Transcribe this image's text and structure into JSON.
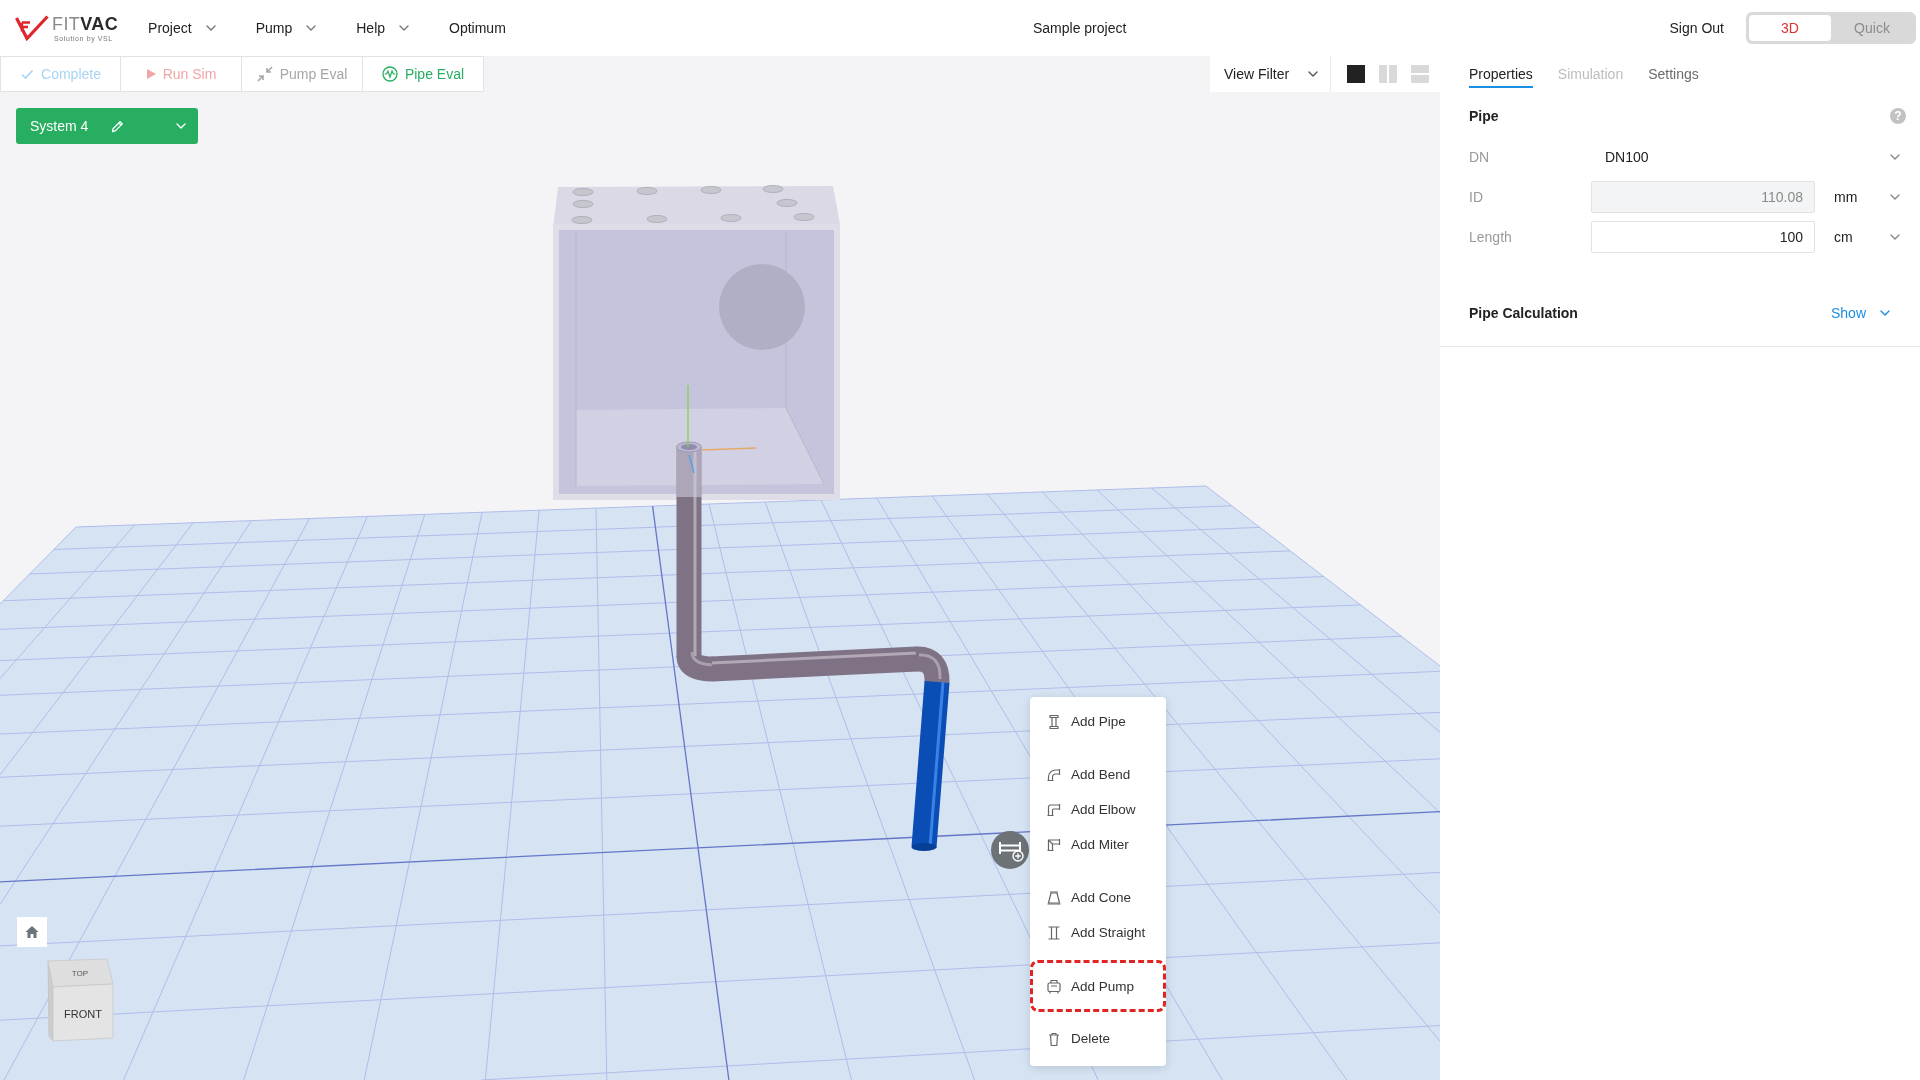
{
  "header": {
    "logo": {
      "wordmark": "FIT**VAC**",
      "tagline": "Solution by VSL"
    },
    "menu": [
      {
        "label": "Project",
        "dropdown": true
      },
      {
        "label": "Pump",
        "dropdown": true
      },
      {
        "label": "Help",
        "dropdown": true
      },
      {
        "label": "Optimum",
        "dropdown": false
      }
    ],
    "title": "Sample project",
    "sign_out": "Sign Out",
    "modes": [
      {
        "label": "3D",
        "selected": true
      },
      {
        "label": "Quick",
        "selected": false
      }
    ]
  },
  "toolbar": {
    "actions": [
      {
        "label": "Complete",
        "kind": "check",
        "color": "#a8d3f3"
      },
      {
        "label": "Run Sim",
        "kind": "play",
        "color": "#f2a5a5"
      },
      {
        "label": "Pump Eval",
        "kind": "compress",
        "color": "#a6a6a6"
      },
      {
        "label": "Pipe Eval",
        "kind": "wave",
        "color": "#27ae60"
      }
    ],
    "view_filter": "View Filter",
    "layouts": [
      {
        "kind": "single",
        "selected": true
      },
      {
        "kind": "columns",
        "selected": false
      },
      {
        "kind": "rows",
        "selected": false
      }
    ]
  },
  "system": {
    "label": "System 4"
  },
  "scene": {
    "pipe_segments": [
      {
        "selected": false
      },
      {
        "selected": false
      },
      {
        "selected": true
      }
    ],
    "view_cube": {
      "top": "TOP",
      "front": "FRONT"
    }
  },
  "context_menu": {
    "groups": [
      {
        "items": [
          {
            "label": "Add Pipe",
            "kind": "pipe",
            "highlighted": false
          }
        ]
      },
      {
        "items": [
          {
            "label": "Add Bend",
            "kind": "bend",
            "highlighted": false
          },
          {
            "label": "Add Elbow",
            "kind": "elbow",
            "highlighted": false
          },
          {
            "label": "Add Miter",
            "kind": "miter",
            "highlighted": false
          }
        ]
      },
      {
        "items": [
          {
            "label": "Add Cone",
            "kind": "cone",
            "highlighted": false
          },
          {
            "label": "Add Straight",
            "kind": "straight",
            "highlighted": false
          }
        ]
      },
      {
        "items": [
          {
            "label": "Add Pump",
            "kind": "pump",
            "highlighted": true
          }
        ]
      },
      {
        "items": [
          {
            "label": "Delete",
            "kind": "delete",
            "highlighted": false
          }
        ]
      }
    ]
  },
  "panel": {
    "tabs": [
      {
        "label": "Properties",
        "selected": true,
        "disabled": false
      },
      {
        "label": "Simulation",
        "selected": false,
        "disabled": true
      },
      {
        "label": "Settings",
        "selected": false,
        "disabled": false
      }
    ],
    "section": {
      "title": "Pipe",
      "help": "?",
      "fields": [
        {
          "label": "DN",
          "kind": "select",
          "value": "DN100"
        },
        {
          "label": "ID",
          "kind": "readonly",
          "value": "110.08",
          "unit": "mm"
        },
        {
          "label": "Length",
          "kind": "input",
          "value": "100",
          "unit": "cm"
        }
      ]
    },
    "calculation": {
      "title": "Pipe Calculation",
      "toggle": "Show"
    }
  }
}
